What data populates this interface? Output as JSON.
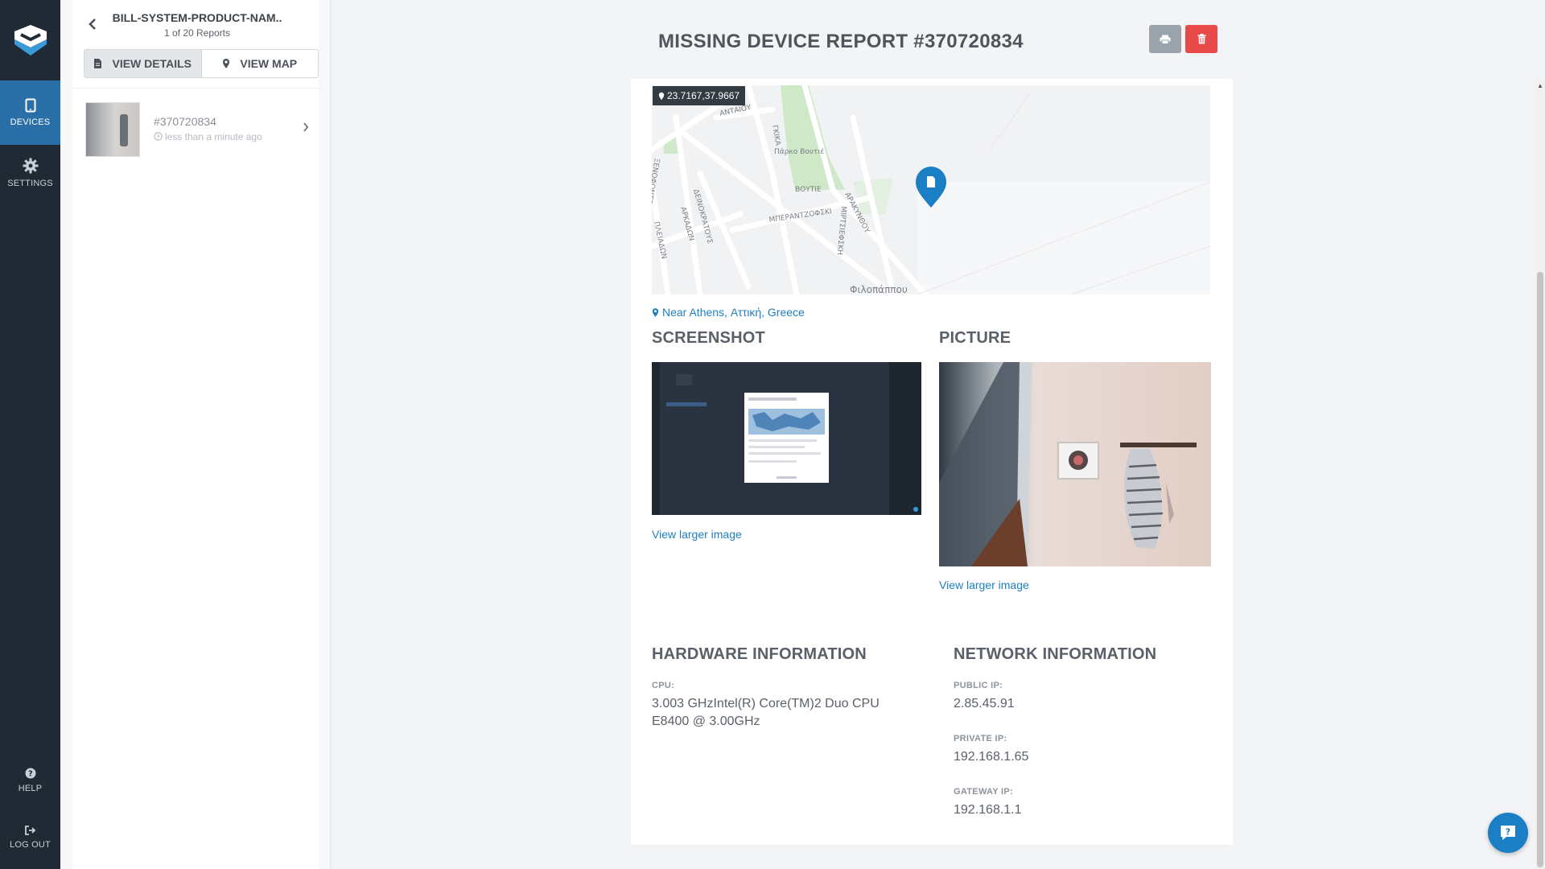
{
  "nav": {
    "devices_label": "DEVICES",
    "settings_label": "SETTINGS",
    "help_label": "HELP",
    "logout_label": "LOG OUT"
  },
  "panel": {
    "device_name": "BILL-SYSTEM-PRODUCT-NAM..",
    "report_count": "1 of 20 Reports",
    "tabs": {
      "details": "VIEW DETAILS",
      "map": "VIEW MAP"
    },
    "reports": [
      {
        "id": "#370720834",
        "time": "less than a minute ago"
      }
    ]
  },
  "report": {
    "title": "MISSING DEVICE REPORT #370720834",
    "coordinates": "23.7167,37.9667",
    "location": "Near Athens, Αττική, Greece",
    "map_labels": [
      "ΑΝΤΑΙΟΥ",
      "ΓΚΙΚΑ",
      "Πάρκο Βουτιέ",
      "ΒΟΥΤΙΕ",
      "ΜΠΕΡΑΝΤΖΟΦΣΚΙ",
      "ΑΡΑΚΥΝΘΟΥ",
      "ΜΙΡΤΣΙΕΦΣΚΗ",
      "ΔΕΙΝΟΚΡΑΤΟΥΣ",
      "ΑΡΚΑΔΩΝ",
      "ΠΛΕΙΑΔΩΝ",
      "ΞΕΝΟΦΩΝΤΟΣ",
      "Φιλοπάππου"
    ],
    "screenshot_title": "SCREENSHOT",
    "picture_title": "PICTURE",
    "view_larger": "View larger image",
    "hardware": {
      "title": "HARDWARE INFORMATION",
      "cpu_label": "CPU:",
      "cpu_value": "3.003 GHzIntel(R) Core(TM)2 Duo CPU E8400 @ 3.00GHz"
    },
    "network": {
      "title": "NETWORK INFORMATION",
      "public_ip_label": "PUBLIC IP:",
      "public_ip": "2.85.45.91",
      "private_ip_label": "PRIVATE IP:",
      "private_ip": "192.168.1.65",
      "gateway_ip_label": "GATEWAY IP:",
      "gateway_ip": "192.168.1.1"
    }
  },
  "colors": {
    "rail_bg": "#1f2a35",
    "active_nav": "#2b6fa8",
    "link": "#1f7fbf",
    "danger": "#e84a4a",
    "print_btn": "#9aa3ab"
  },
  "icons": {
    "logo": "shield-logo-icon",
    "devices": "tablet-icon",
    "settings": "gear-icon",
    "help": "question-circle-icon",
    "logout": "sign-out-icon",
    "back": "chevron-left-icon",
    "details": "file-icon",
    "map": "map-marker-icon",
    "print": "print-icon",
    "delete": "trash-icon",
    "time": "clock-icon",
    "fab": "help-chat-icon"
  }
}
